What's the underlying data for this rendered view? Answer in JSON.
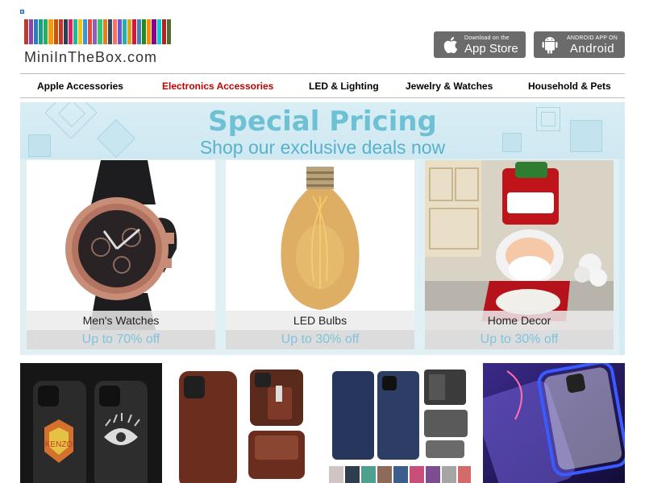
{
  "header": {
    "logo_text": "MiniInTheBox.com",
    "logo_stripe_colors": [
      "#c0392b",
      "#8e44ad",
      "#2980b9",
      "#16a085",
      "#27ae60",
      "#f39c12",
      "#d35400",
      "#c0392b",
      "#2c3e50",
      "#e91e63",
      "#1abc9c",
      "#f1c40f",
      "#3498db",
      "#e74c3c",
      "#9b59b6",
      "#2ecc71",
      "#e67e22",
      "#34495e",
      "#ff6f61",
      "#6a5acd",
      "#20b2aa",
      "#daa520",
      "#dc143c",
      "#4682b4",
      "#228b22",
      "#ff8c00",
      "#8b008b",
      "#00ced1",
      "#b22222",
      "#556b2f"
    ],
    "app_store": {
      "small": "Download on the",
      "big": "App Store",
      "icon": "apple-icon"
    },
    "android": {
      "small": "ANDROID APP ON",
      "big": "Android",
      "icon": "android-icon"
    }
  },
  "nav": {
    "items": [
      {
        "label": "Apple Accessories",
        "active": false
      },
      {
        "label": "Electronics Accessories",
        "active": true
      },
      {
        "label": "LED & Lighting",
        "active": false
      },
      {
        "label": "Jewelry & Watches",
        "active": false
      },
      {
        "label": "Household & Pets",
        "active": false
      }
    ],
    "active_color": "#c00000"
  },
  "promo": {
    "title": "Special Pricing",
    "subtitle": "Shop our exclusive deals now",
    "cards": [
      {
        "label": "Men's Watches",
        "deal": "Up to 70% off"
      },
      {
        "label": "LED Bulbs",
        "deal": "Up to 30% off"
      },
      {
        "label": "Home Decor",
        "deal": "Up to 30% off"
      }
    ]
  },
  "products": [
    {
      "name": "tiger-eye-phone-cases"
    },
    {
      "name": "brown-leather-wallet-case"
    },
    {
      "name": "blue-flip-wallet-case"
    },
    {
      "name": "magnetic-glass-case"
    }
  ]
}
